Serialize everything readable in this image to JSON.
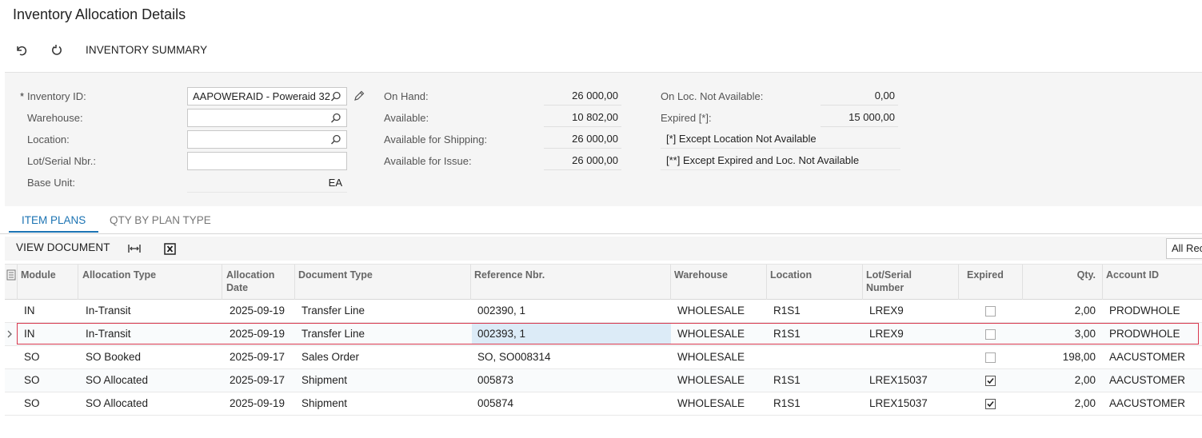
{
  "page": {
    "title": "Inventory Allocation Details"
  },
  "toolbar": {
    "undo_icon": "undo-icon",
    "refresh_icon": "refresh-icon",
    "inventory_summary_label": "INVENTORY SUMMARY"
  },
  "form": {
    "inventory_id": {
      "label": "Inventory ID:",
      "required_mark": "*",
      "value": "AAPOWERAID - Poweraid 32"
    },
    "warehouse": {
      "label": "Warehouse:",
      "value": ""
    },
    "location": {
      "label": "Location:",
      "value": ""
    },
    "lot_serial": {
      "label": "Lot/Serial Nbr.:",
      "value": ""
    },
    "base_unit": {
      "label": "Base Unit:",
      "value": "EA"
    },
    "on_hand": {
      "label": "On Hand:",
      "value": "26 000,00"
    },
    "available": {
      "label": "Available:",
      "value": "10 802,00"
    },
    "available_for_shipping": {
      "label": "Available for Shipping:",
      "value": "26 000,00"
    },
    "available_for_issue": {
      "label": "Available for Issue:",
      "value": "26 000,00"
    },
    "on_loc_not_available": {
      "label": "On Loc. Not Available:",
      "value": "0,00"
    },
    "expired": {
      "label": "Expired [*]:",
      "value": "15 000,00"
    },
    "note1": "[*]  Except Location Not Available",
    "note2": "[**] Except Expired and  Loc. Not Available"
  },
  "tabs": [
    {
      "label": "ITEM PLANS",
      "active": true
    },
    {
      "label": "QTY BY PLAN TYPE",
      "active": false
    }
  ],
  "grid_toolbar": {
    "view_document_label": "VIEW DOCUMENT",
    "fit_columns_icon": "fit-columns-icon",
    "export_excel_icon": "export-excel-icon",
    "records_filter": "All Rec"
  },
  "grid": {
    "columns": [
      "Module",
      "Allocation Type",
      "Allocation Date",
      "Document Type",
      "Reference Nbr.",
      "Warehouse",
      "Location",
      "Lot/Serial Number",
      "Expired",
      "Qty.",
      "Account ID"
    ],
    "rows": [
      {
        "module": "IN",
        "allocation_type": "In-Transit",
        "allocation_date": "2025-09-19",
        "document_type": "Transfer Line",
        "reference_nbr": "002390, 1",
        "warehouse": "WHOLESALE",
        "location": "R1S1",
        "lot_serial": "LREX9",
        "expired": false,
        "qty": "2,00",
        "account_id": "PRODWHOLE"
      },
      {
        "module": "IN",
        "allocation_type": "In-Transit",
        "allocation_date": "2025-09-19",
        "document_type": "Transfer Line",
        "reference_nbr": "002393, 1",
        "warehouse": "WHOLESALE",
        "location": "R1S1",
        "lot_serial": "LREX9",
        "expired": false,
        "qty": "3,00",
        "account_id": "PRODWHOLE"
      },
      {
        "module": "SO",
        "allocation_type": "SO Booked",
        "allocation_date": "2025-09-17",
        "document_type": "Sales Order",
        "reference_nbr": "SO, SO008314",
        "warehouse": "WHOLESALE",
        "location": "",
        "lot_serial": "",
        "expired": false,
        "qty": "198,00",
        "account_id": "AACUSTOMER"
      },
      {
        "module": "SO",
        "allocation_type": "SO Allocated",
        "allocation_date": "2025-09-17",
        "document_type": "Shipment",
        "reference_nbr": "005873",
        "warehouse": "WHOLESALE",
        "location": "R1S1",
        "lot_serial": "LREX15037",
        "expired": true,
        "qty": "2,00",
        "account_id": "AACUSTOMER"
      },
      {
        "module": "SO",
        "allocation_type": "SO Allocated",
        "allocation_date": "2025-09-19",
        "document_type": "Shipment",
        "reference_nbr": "005874",
        "warehouse": "WHOLESALE",
        "location": "R1S1",
        "lot_serial": "LREX15037",
        "expired": true,
        "qty": "2,00",
        "account_id": "AACUSTOMER"
      }
    ],
    "selected_row": 1
  },
  "colors": {
    "accent": "#1b73b3",
    "selection_border": "#d9394f",
    "selection_fill": "#dcebf7"
  }
}
